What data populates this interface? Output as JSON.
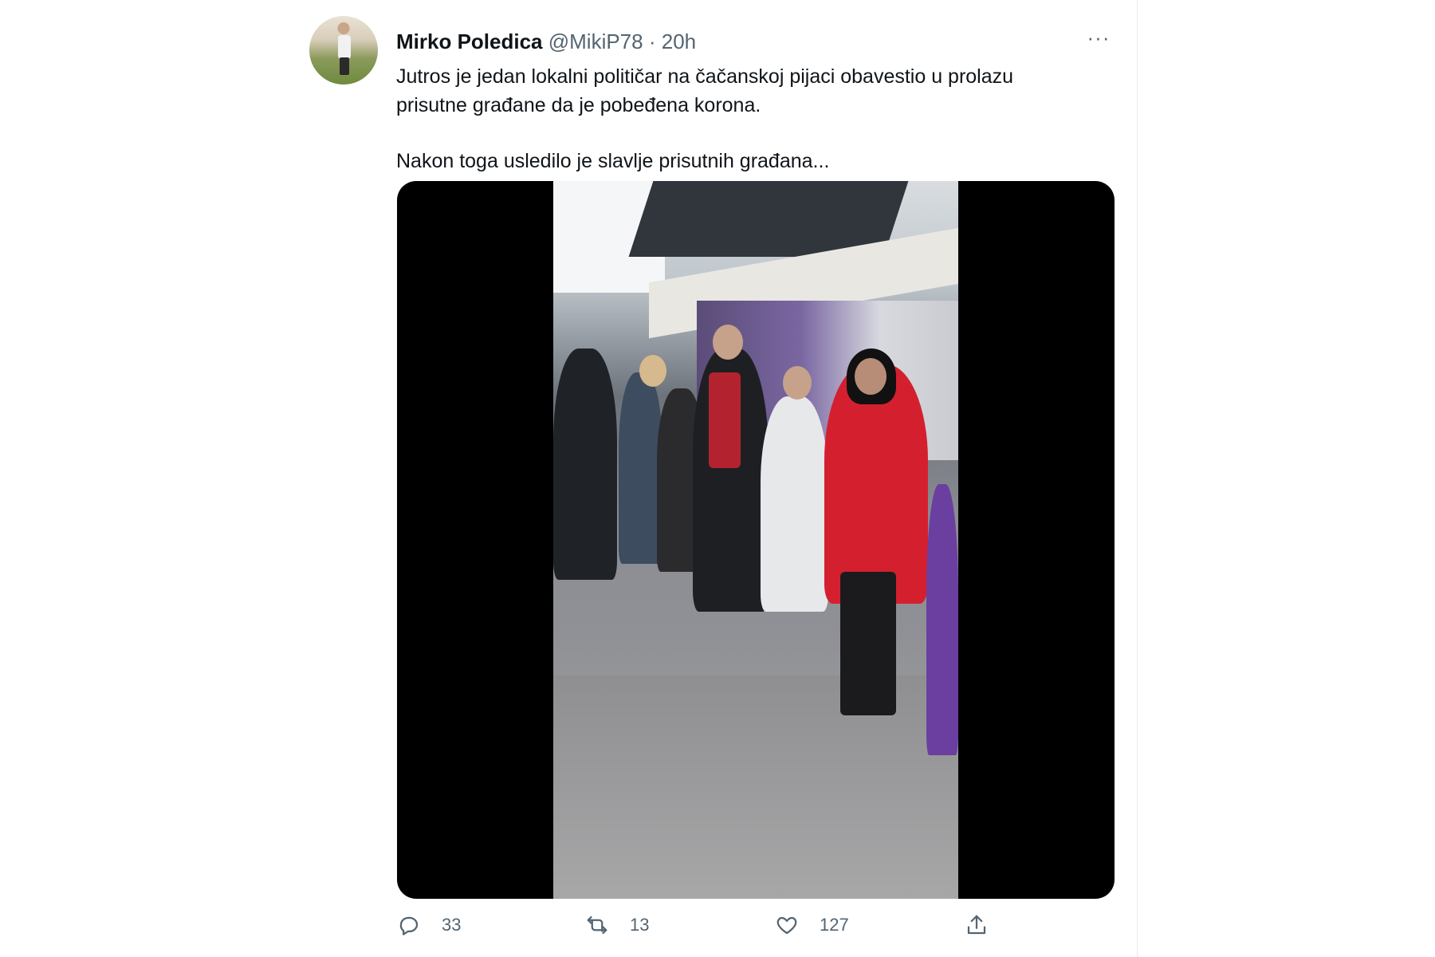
{
  "tweet": {
    "author_name": "Mirko Poledica",
    "handle": "@MikiP78",
    "separator": "·",
    "time": "20h",
    "more_label": "···",
    "text_line1": "Jutros je jedan lokalni političar na čačanskoj pijaci obavestio u prolazu",
    "text_line2": "prisutne građane da je pobeđena korona.",
    "text_line3": "Nakon toga usledilo je slavlje prisutnih građana...",
    "media": {
      "type": "video"
    },
    "stats": {
      "replies": "33",
      "retweets": "13",
      "likes": "127"
    }
  },
  "icons": {
    "reply": "reply-icon",
    "retweet": "retweet-icon",
    "like": "heart-icon",
    "share": "share-icon",
    "more": "more-icon"
  },
  "colors": {
    "text_primary": "#0f1419",
    "text_secondary": "#536471",
    "divider": "#e6ecf0"
  }
}
